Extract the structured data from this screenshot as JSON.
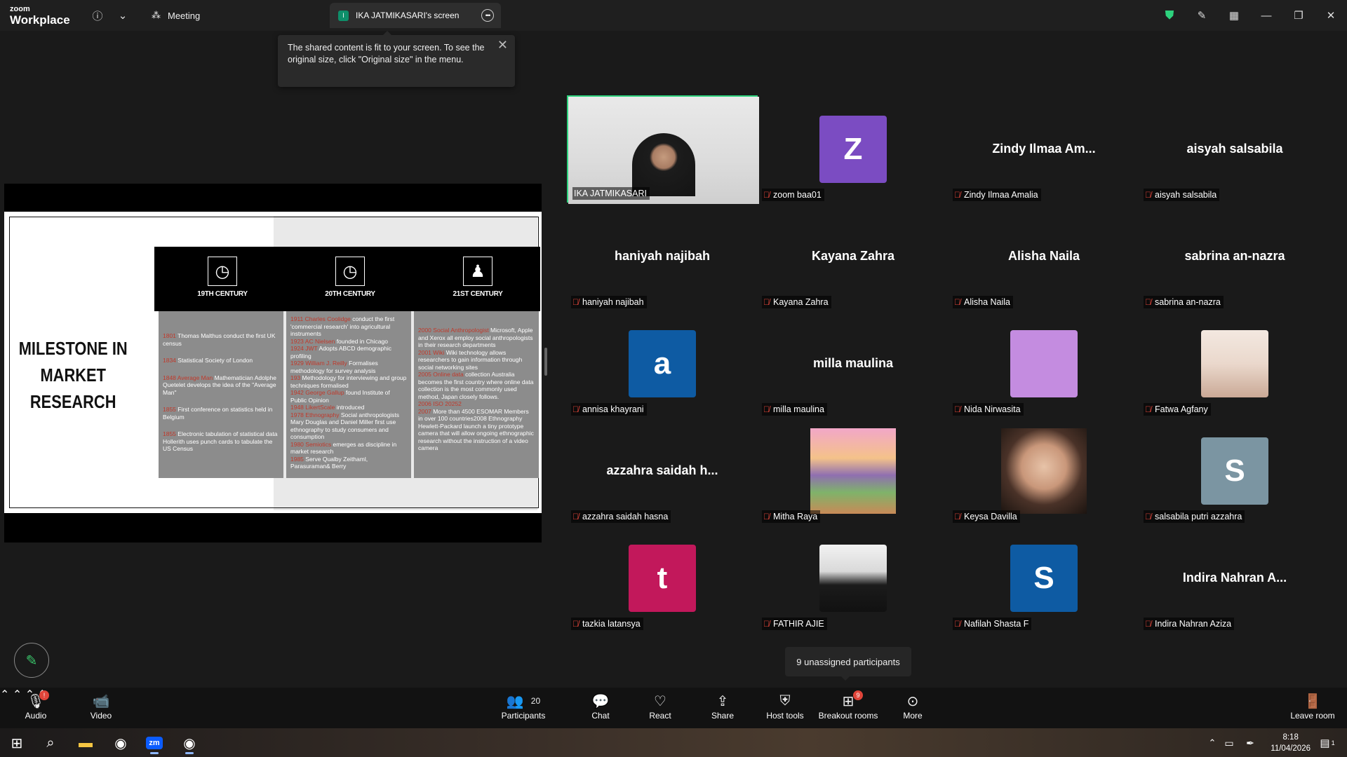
{
  "app": {
    "brand_top": "zoom",
    "brand_bottom": "Workplace"
  },
  "titlebar": {
    "meeting_label": "Meeting",
    "screen_tab_badge": "I",
    "screen_tab_label": "IKA JATMIKASARI's screen"
  },
  "tooltip": {
    "text": "The shared content is fit to your screen. To see the original size, click \"Original size\" in the menu."
  },
  "slide": {
    "title_line1": "MILESTONE IN",
    "title_line2": "MARKET RESEARCH",
    "columns": [
      {
        "header": "19TH CENTURY",
        "icon": "clock-icon",
        "entries": [
          {
            "year": "1801",
            "text": "Thomas Malthus conduct the first UK census"
          },
          {
            "year": "1834",
            "text": "Statistical Society of London"
          },
          {
            "year": "1848 Average Man",
            "text": "Mathematician Adolphe Quetelet develops the idea of the \"Average Man\""
          },
          {
            "year": "1855",
            "text": "First conference on statistics held in Belgium"
          },
          {
            "year": "1855",
            "text": "Electronic tabulation of statistical data Hollerith uses punch cards to tabulate the US Census"
          }
        ]
      },
      {
        "header": "20TH CENTURY",
        "icon": "clock-icon",
        "entries": [
          {
            "year": "1911 Charles Coolidge",
            "text": "conduct the first 'commercial research' into agricultural instruments"
          },
          {
            "year": "1923 AC Nielsen",
            "text": "founded in Chicago"
          },
          {
            "year": "1924 JWT",
            "text": "Adopts ABCD demographic profiling"
          },
          {
            "year": "1929 William J. Reilly",
            "text": "Formalises methodology for survey analysis"
          },
          {
            "year": "193",
            "text": "Methodology for interviewing and group techniques formalised"
          },
          {
            "year": "1942 George Gallup",
            "text": "found Institute of Public Opinion"
          },
          {
            "year": "1948 LikertScale",
            "text": "introduced"
          },
          {
            "year": "1978 Ethnography",
            "text": "Social anthropologists Mary Douglas and Daniel Miller first use ethnography to study consumers and consumption"
          },
          {
            "year": "1980 Semiotics",
            "text": "emerges as discipline in market research"
          },
          {
            "year": "1985",
            "text": "Serve Qualby Zeithaml, Parasuraman& Berry"
          }
        ]
      },
      {
        "header": "21ST CENTURY",
        "icon": "people-icon",
        "entries": [
          {
            "year": "2000 Social Anthropologist",
            "text": "Microsoft, Apple and Xerox all employ social anthropologists in their research departments"
          },
          {
            "year": "2001 Wiki",
            "text": "Wiki technology allows researchers to gain information through social networking sites"
          },
          {
            "year": "2005 Online data",
            "text": "collection Australia becomes the first country where online data collection is the most commonly used method, Japan closely follows."
          },
          {
            "year": "2006 ISO 20252",
            "text": ""
          },
          {
            "year": "2007",
            "text": "More than 4500 ESOMAR Members in over 100 countries2008 Ethnography Hewlett-Packard launch a tiny prototype camera that will allow ongoing ethnographic research without the instruction of a video camera"
          }
        ]
      }
    ]
  },
  "participants": [
    {
      "kind": "video",
      "name": "IKA JATMIKASARI",
      "active": true,
      "muted": false
    },
    {
      "kind": "avatar",
      "initial": "Z",
      "color": "#7b4cc2",
      "name": "zoom baa01",
      "muted": true
    },
    {
      "kind": "name",
      "display": "Zindy Ilmaa Am...",
      "name": "Zindy Ilmaa Amalia",
      "muted": true
    },
    {
      "kind": "name",
      "display": "aisyah salsabila",
      "name": "aisyah salsabila",
      "muted": true
    },
    {
      "kind": "name",
      "display": "haniyah najibah",
      "name": "haniyah najibah",
      "muted": true
    },
    {
      "kind": "name",
      "display": "Kayana Zahra",
      "name": "Kayana Zahra",
      "muted": true
    },
    {
      "kind": "name",
      "display": "Alisha Naila",
      "name": "Alisha Naila",
      "muted": true
    },
    {
      "kind": "name",
      "display": "sabrina an-nazra",
      "name": "sabrina an-nazra",
      "muted": true
    },
    {
      "kind": "avatar",
      "initial": "a",
      "color": "#0e5ba3",
      "name": "annisa khayrani",
      "muted": true
    },
    {
      "kind": "name",
      "display": "milla maulina",
      "name": "milla maulina",
      "muted": true
    },
    {
      "kind": "avatar",
      "initial": "",
      "color": "#c48ce0",
      "name": "Nida Nirwasita",
      "muted": true
    },
    {
      "kind": "photo",
      "photo": "hijab",
      "name": "Fatwa Agfany",
      "muted": true
    },
    {
      "kind": "name",
      "display": "azzahra saidah h...",
      "name": "azzahra saidah hasna",
      "muted": true
    },
    {
      "kind": "photo",
      "photo": "painting",
      "name": "Mitha Raya",
      "muted": true
    },
    {
      "kind": "photo",
      "photo": "face",
      "name": "Keysa Davilla",
      "muted": true
    },
    {
      "kind": "avatar",
      "initial": "S",
      "color": "#7b95a2",
      "name": "salsabila putri azzahra",
      "muted": true
    },
    {
      "kind": "avatar",
      "initial": "t",
      "color": "#c2185b",
      "name": "tazkia latansya",
      "muted": true
    },
    {
      "kind": "photo",
      "photo": "selfie",
      "name": "FATHIR AJIE",
      "muted": true
    },
    {
      "kind": "avatar",
      "initial": "S",
      "color": "#0e5ba3",
      "name": "Nafilah Shasta F",
      "muted": true
    },
    {
      "kind": "name",
      "display": "Indira Nahran A...",
      "name": "Indira Nahran Aziza",
      "muted": true
    }
  ],
  "unassigned": {
    "text": "9 unassigned participants"
  },
  "toolbar": {
    "audio": "Audio",
    "video": "Video",
    "participants": "Participants",
    "participants_count": "20",
    "chat": "Chat",
    "react": "React",
    "share": "Share",
    "host_tools": "Host tools",
    "breakout": "Breakout rooms",
    "breakout_badge": "9",
    "more": "More",
    "leave": "Leave room"
  },
  "taskbar": {
    "time": "8:18",
    "date": "11/04/2026",
    "notif": "1"
  },
  "colors": {
    "accent_green": "#2dd27d",
    "mute_red": "#e0453a",
    "slide_year_red": "#c0392b"
  }
}
